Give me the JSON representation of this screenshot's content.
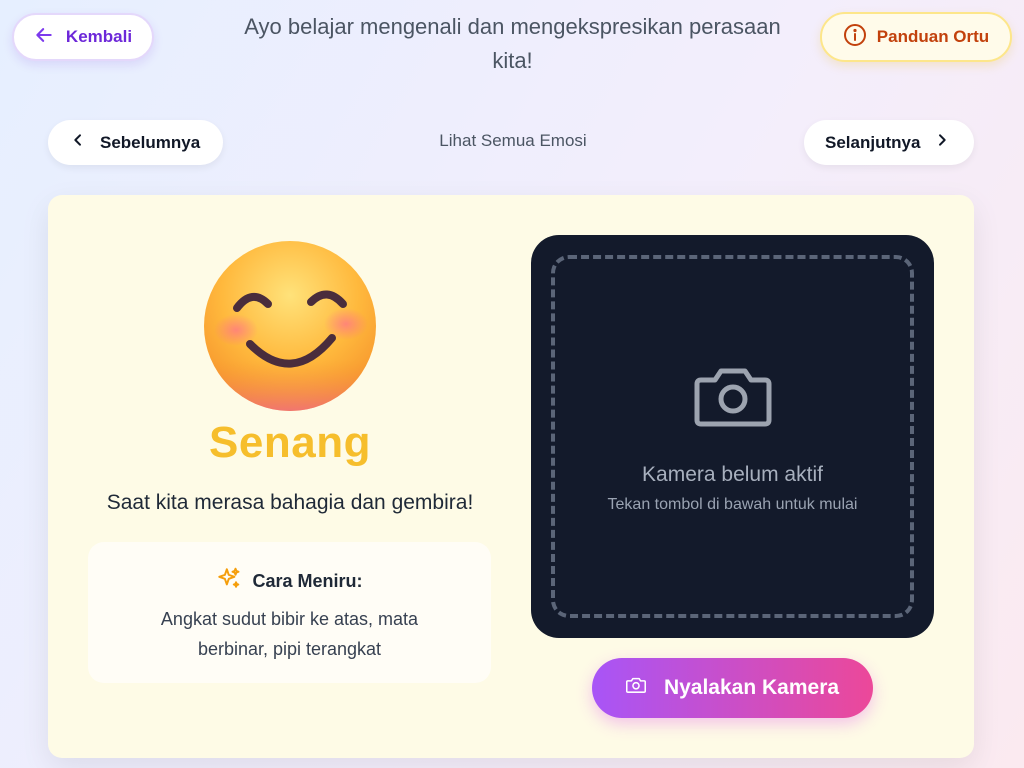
{
  "header": {
    "back_label": "Kembali",
    "subtitle": "Ayo belajar mengenali dan mengekspresikan perasaan kita!",
    "guide_label": "Panduan Ortu"
  },
  "nav": {
    "prev_label": "Sebelumnya",
    "all_label": "Lihat Semua Emosi",
    "next_label": "Selanjutnya"
  },
  "emotion": {
    "name": "Senang",
    "description": "Saat kita merasa bahagia dan gembira!",
    "how_to_title": "Cara Meniru:",
    "how_to_text": "Angkat sudut bibir ke atas, mata berbinar, pipi terangkat",
    "icon": "smiling-face-emoji"
  },
  "camera": {
    "status": "Kamera belum aktif",
    "hint": "Tekan tombol di bawah untuk mulai",
    "button_label": "Nyalakan Kamera"
  },
  "colors": {
    "accent_purple": "#6d28d9",
    "guide_orange": "#c2410c",
    "emotion_yellow": "#f6be2c",
    "button_gradient_start": "#a855f7",
    "button_gradient_end": "#ec4899",
    "camera_bg": "#131a2b"
  }
}
